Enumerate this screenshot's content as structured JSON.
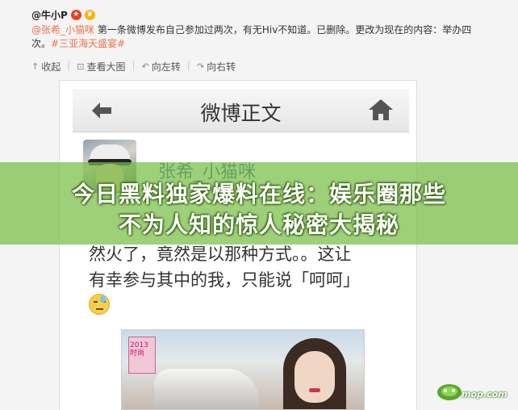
{
  "post": {
    "author": "@牛小P",
    "mention": "@张希_小猫咪",
    "text": " 第一条微博发布自己参加过两次，有无Hiv不知道。已删除。更改为现在的内容：举办四次。",
    "topic": "#三亚海天盛宴#"
  },
  "actions": [
    {
      "icon": "collapse-icon",
      "label": "收起"
    },
    {
      "icon": "zoom-icon",
      "label": "查看大图"
    },
    {
      "icon": "rotate-left-icon",
      "label": "向左转"
    },
    {
      "icon": "rotate-right-icon",
      "label": "向右转"
    }
  ],
  "screenshot": {
    "title": "微博正文",
    "username": "张希_小猫咪",
    "lines": [
      "然火了，竟然是以那种方式。。这让",
      "有幸参与其中的我，只能说「呵呵」"
    ],
    "poster_text": "2013 时尚"
  },
  "banner": {
    "line1": "今日黑料独家爆料在线：娱乐圈那些",
    "line2": "不为人知的惊人秘密大揭秘"
  },
  "watermark": "mop.com",
  "colors": {
    "link": "#eb7350",
    "username": "#2b5f9a",
    "banner_bg": "#78be46"
  }
}
